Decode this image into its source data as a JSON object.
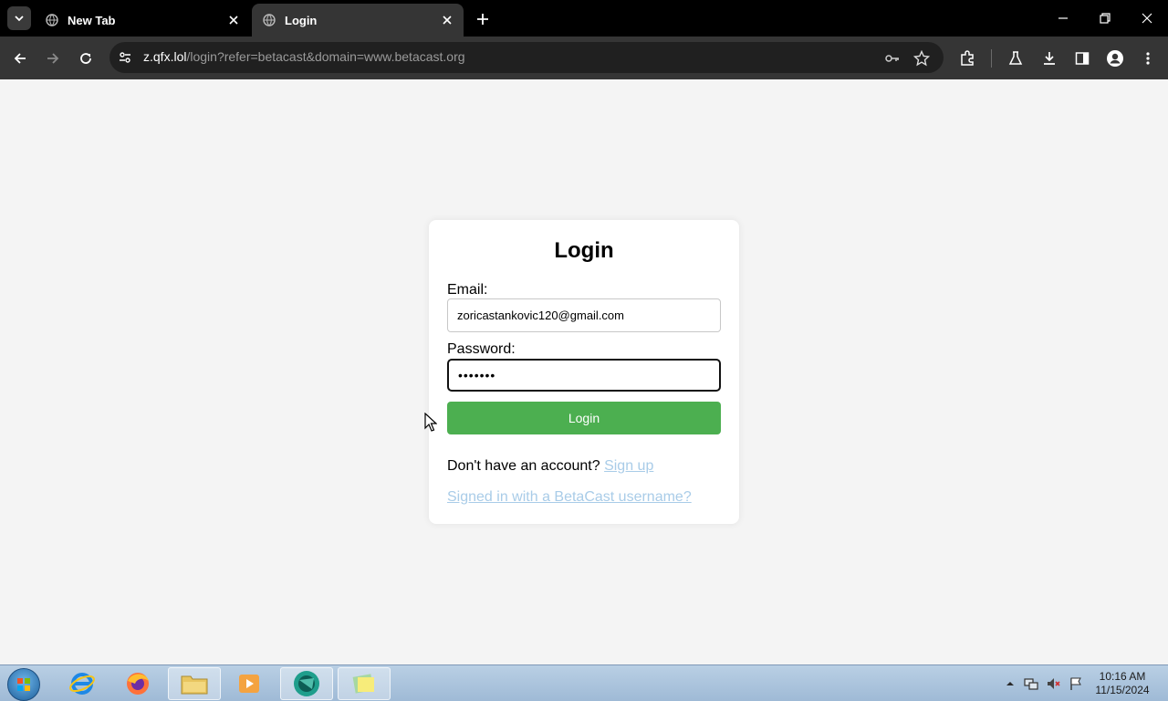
{
  "browser": {
    "tabs": [
      {
        "title": "New Tab"
      },
      {
        "title": "Login"
      }
    ],
    "address_bar": {
      "host": "z.qfx.lol",
      "path": "/login?refer=betacast&domain=www.betacast.org"
    }
  },
  "login_page": {
    "title": "Login",
    "email_label": "Email:",
    "email_value": "zoricastankovic120@gmail.com",
    "password_label": "Password:",
    "password_value": "•••••••",
    "login_button": "Login",
    "signup_prompt": "Don't have an account?",
    "signup_link": "Sign up",
    "betacast_link": "Signed in with a BetaCast username?"
  },
  "taskbar": {
    "clock_time": "10:16 AM",
    "clock_date": "11/15/2024"
  },
  "colors": {
    "accent_green": "#4caf50",
    "link": "#a9cce8",
    "page_bg": "#f4f4f4"
  }
}
